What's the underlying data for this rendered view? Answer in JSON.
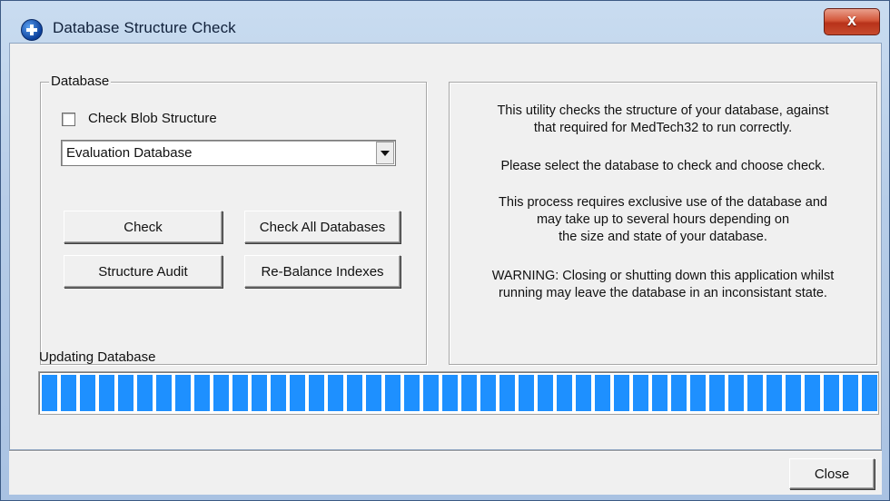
{
  "window": {
    "title": "Database Structure Check",
    "close_glyph": "x"
  },
  "database_group": {
    "label": "Database",
    "blob_checkbox": {
      "label": "Check Blob Structure",
      "checked": false
    },
    "database_select": {
      "value": "Evaluation Database"
    },
    "buttons": {
      "check": "Check",
      "check_all": "Check All Databases",
      "structure_audit": "Structure Audit",
      "rebalance": "Re-Balance Indexes"
    }
  },
  "description": {
    "line1": "This utility checks the structure of your database, against",
    "line2": "that required for MedTech32 to run correctly.",
    "line3": "Please select the database to check and choose check.",
    "line4": "This process requires exclusive use of the database and",
    "line5": "may take up to several hours depending on",
    "line6": "the size and state of your database.",
    "line7": "WARNING: Closing or shutting down this application whilst",
    "line8": "running may leave the database in an inconsistant state."
  },
  "progress": {
    "label": "Updating Database",
    "fraction": 1.0,
    "color": "#1e90ff"
  },
  "footer": {
    "close_label": "Close"
  },
  "icons": {
    "title_icon": "app-cross-icon",
    "dropdown": "chevron-down-icon"
  }
}
